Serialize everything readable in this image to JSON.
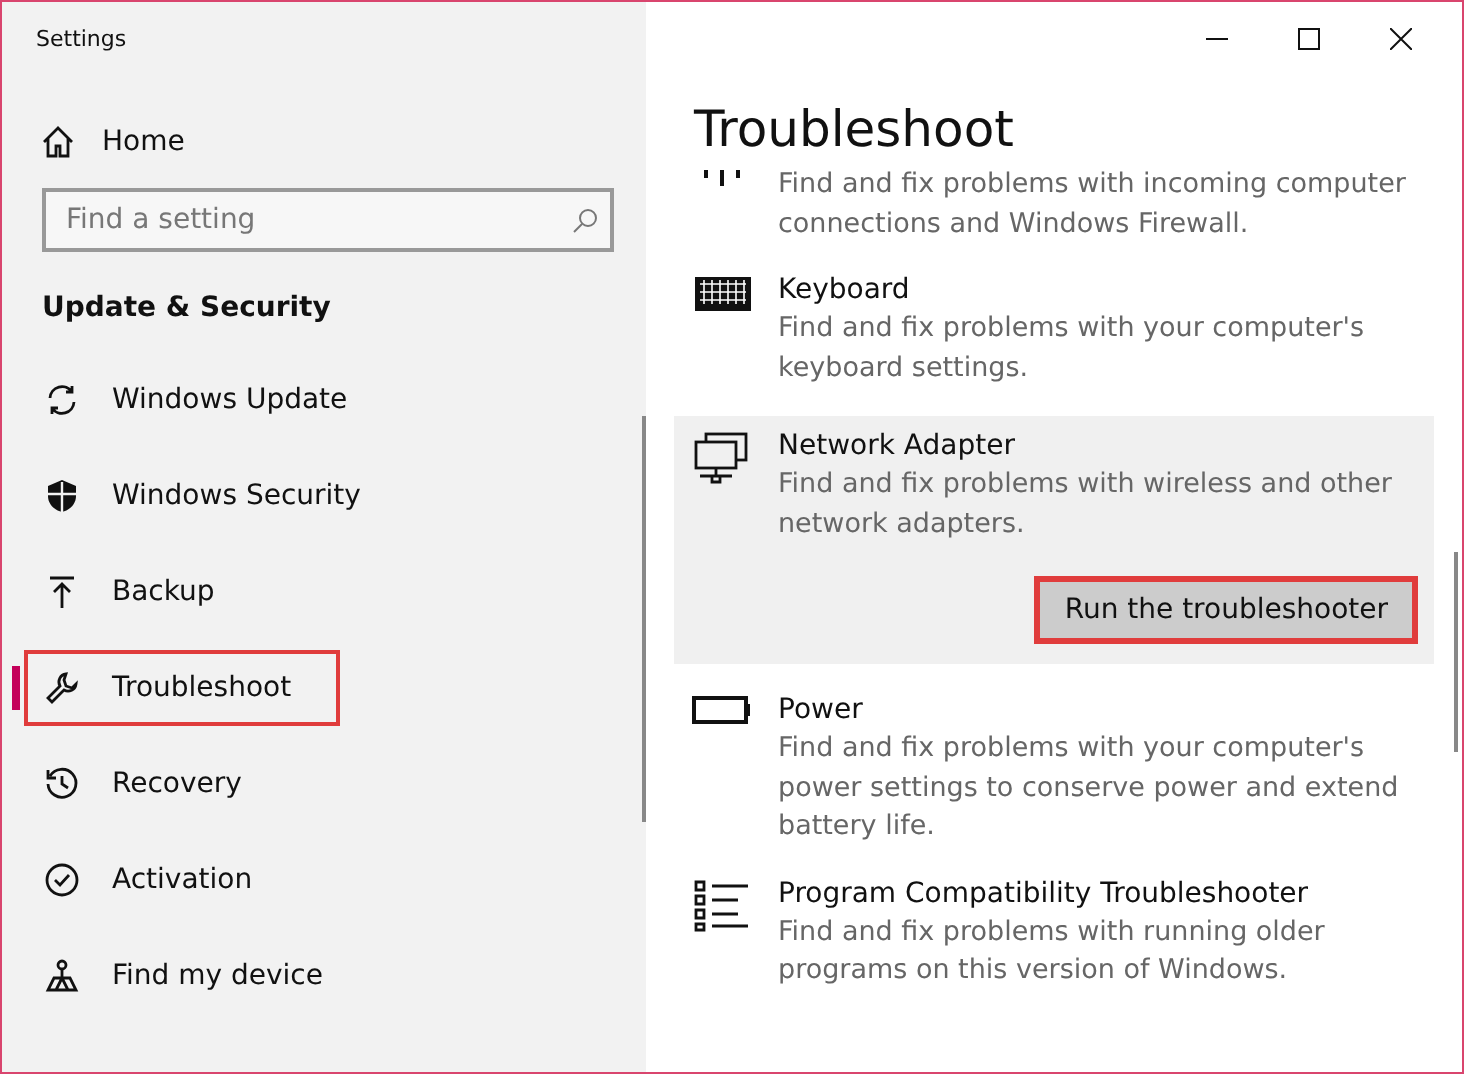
{
  "window": {
    "title": "Settings"
  },
  "sidebar": {
    "home": "Home",
    "search": {
      "placeholder": "Find a setting"
    },
    "section": "Update & Security",
    "items": [
      {
        "label": "Windows Update",
        "selected": false,
        "highlighted": false
      },
      {
        "label": "Windows Security",
        "selected": false,
        "highlighted": false
      },
      {
        "label": "Backup",
        "selected": false,
        "highlighted": false
      },
      {
        "label": "Troubleshoot",
        "selected": true,
        "highlighted": true
      },
      {
        "label": "Recovery",
        "selected": false,
        "highlighted": false
      },
      {
        "label": "Activation",
        "selected": false,
        "highlighted": false
      },
      {
        "label": "Find my device",
        "selected": false,
        "highlighted": false
      }
    ]
  },
  "content": {
    "title": "Troubleshoot",
    "items": [
      {
        "description": "Find and fix problems with incoming computer connections and Windows Firewall.",
        "selected": false
      },
      {
        "title": "Keyboard",
        "description": "Find and fix problems with your computer's keyboard settings.",
        "selected": false
      },
      {
        "title": "Network Adapter",
        "description": "Find and fix problems with wireless and other network adapters.",
        "selected": true,
        "button": {
          "label": "Run the troubleshooter",
          "highlighted": true
        }
      },
      {
        "title": "Power",
        "description": "Find and fix problems with your computer's power settings to conserve power and extend battery life.",
        "selected": false
      },
      {
        "title": "Program Compatibility Troubleshooter",
        "description": "Find and fix problems with running older programs on this version of Windows.",
        "selected": false
      }
    ]
  }
}
